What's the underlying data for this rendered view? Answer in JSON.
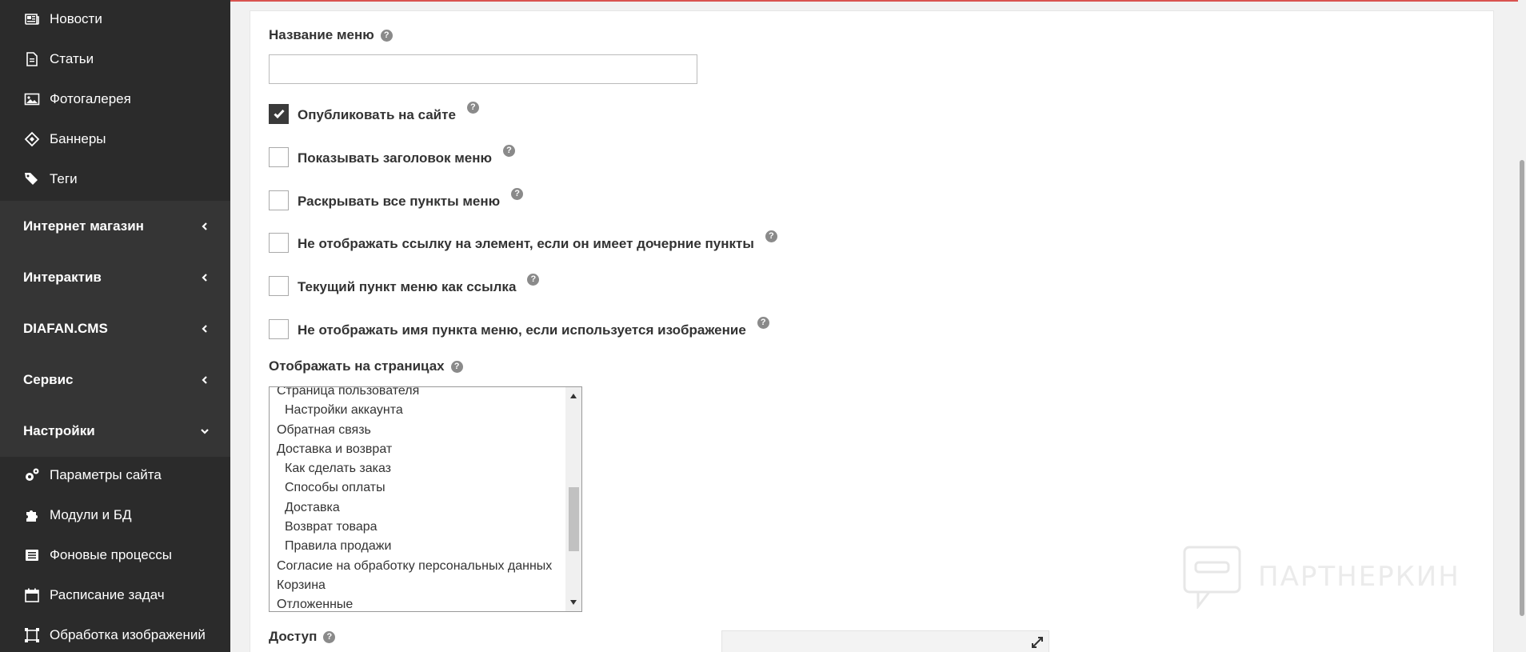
{
  "sidebar": {
    "top_items": [
      {
        "label": "Новости",
        "icon": "newspaper-icon"
      },
      {
        "label": "Статьи",
        "icon": "file-icon"
      },
      {
        "label": "Фотогалерея",
        "icon": "image-icon"
      },
      {
        "label": "Баннеры",
        "icon": "ticket-icon"
      },
      {
        "label": "Теги",
        "icon": "tags-icon"
      }
    ],
    "sections": [
      {
        "label": "Интернет магазин",
        "state": "collapsed"
      },
      {
        "label": "Интерактив",
        "state": "collapsed"
      },
      {
        "label": "DIAFAN.CMS",
        "state": "collapsed"
      },
      {
        "label": "Сервис",
        "state": "collapsed"
      },
      {
        "label": "Настройки",
        "state": "expanded"
      }
    ],
    "bottom_items": [
      {
        "label": "Параметры сайта",
        "icon": "gears-icon"
      },
      {
        "label": "Модули и БД",
        "icon": "puzzle-icon"
      },
      {
        "label": "Фоновые процессы",
        "icon": "list-icon"
      },
      {
        "label": "Расписание задач",
        "icon": "calendar-icon"
      },
      {
        "label": "Обработка изображений",
        "icon": "crop-icon"
      }
    ]
  },
  "form": {
    "menu_name_label": "Название меню",
    "menu_name_value": "",
    "help_glyph": "?",
    "checkboxes": [
      {
        "label": "Опубликовать на сайте",
        "checked": true
      },
      {
        "label": "Показывать заголовок меню",
        "checked": false
      },
      {
        "label": "Раскрывать все пункты меню",
        "checked": false
      },
      {
        "label": "Не отображать ссылку на элемент, если он имеет дочерние пункты",
        "checked": false
      },
      {
        "label": "Текущий пункт меню как ссылка",
        "checked": false
      },
      {
        "label": "Не отображать имя пункта меню, если используется изображение",
        "checked": false
      }
    ],
    "pages_label": "Отображать на страницах",
    "pages_options": [
      {
        "label": "Страница пользователя",
        "indent": false
      },
      {
        "label": "Настройки аккаунта",
        "indent": true
      },
      {
        "label": "Обратная связь",
        "indent": false
      },
      {
        "label": "Доставка и возврат",
        "indent": false
      },
      {
        "label": "Как сделать заказ",
        "indent": true
      },
      {
        "label": "Способы оплаты",
        "indent": true
      },
      {
        "label": "Доставка",
        "indent": true
      },
      {
        "label": "Возврат товара",
        "indent": true
      },
      {
        "label": "Правила продажи",
        "indent": true
      },
      {
        "label": "Согласие на обработку персональных данных",
        "indent": false
      },
      {
        "label": "Корзина",
        "indent": false
      },
      {
        "label": "Отложенные",
        "indent": false
      }
    ],
    "access_label": "Доступ"
  },
  "watermark": {
    "text": "ПАРТНЕРКИН"
  },
  "colors": {
    "sidebar_bg": "#2b2b2b",
    "section_bg": "#353535",
    "accent_line": "#d9534f",
    "checkbox_checked": "#3a3a3a"
  }
}
